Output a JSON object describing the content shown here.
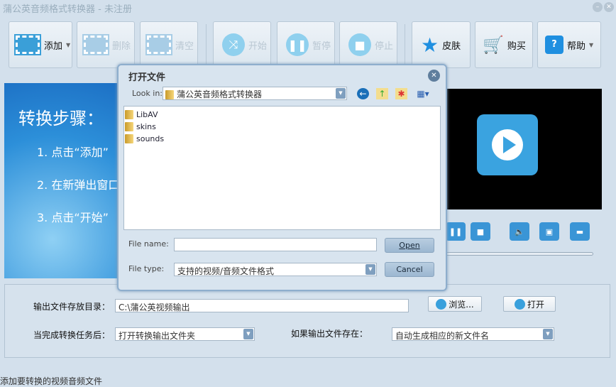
{
  "window": {
    "title": "蒲公英音频格式转换器 - 未注册",
    "minimize": "–",
    "close": "✕"
  },
  "toolbar": {
    "add": "添加",
    "delete": "删除",
    "clear": "清空",
    "start": "开始",
    "pause": "暂停",
    "stop": "停止",
    "skin": "皮肤",
    "buy": "购买",
    "help": "帮助"
  },
  "steps": {
    "title": "转换步骤：",
    "s1": "1. 点击“添加”",
    "s2": "2. 在新弹出窗口",
    "s3": "3. 点击“开始”"
  },
  "output": {
    "dir_label": "输出文件存放目录：",
    "dir_value": "C:\\蒲公英视频输出",
    "browse": "浏览...",
    "open": "打开",
    "after_label": "当完成转换任务后：",
    "after_value": "打开转换输出文件夹",
    "exists_label": "如果输出文件存在：",
    "exists_value": "自动生成相应的新文件名"
  },
  "status": "添加要转换的视频音频文件",
  "dialog": {
    "title": "打开文件",
    "look_in_label": "Look in:",
    "look_in_value": "蒲公英音频格式转换器",
    "files": [
      "LibAV",
      "skins",
      "sounds"
    ],
    "file_name_label": "File name:",
    "file_name_value": "",
    "file_type_label": "File type:",
    "file_type_value": "支持的视频/音频文件格式",
    "open": "Open",
    "cancel": "Cancel"
  }
}
